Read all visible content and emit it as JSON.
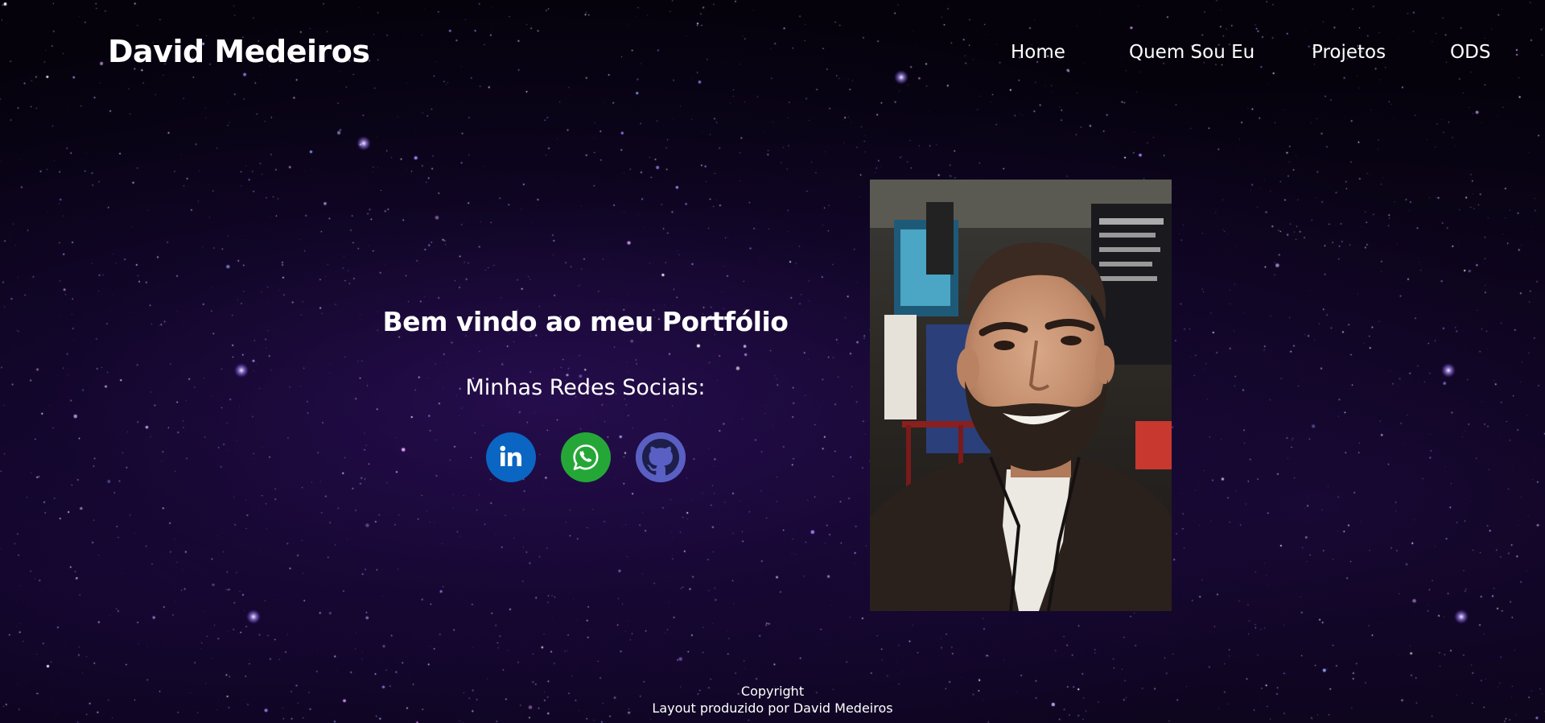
{
  "header": {
    "brand": "David Medeiros",
    "nav": [
      {
        "label": "Home"
      },
      {
        "label": "Quem Sou Eu"
      },
      {
        "label": "Projetos"
      },
      {
        "label": "ODS"
      }
    ]
  },
  "hero": {
    "title": "Bem vindo ao meu Portfólio",
    "social_label": "Minhas Redes Sociais:",
    "social": [
      {
        "icon": "linkedin-icon",
        "color": "#0a66c2"
      },
      {
        "icon": "whatsapp-icon",
        "color": "#25a737"
      },
      {
        "icon": "github-icon",
        "color": "#5a5fc3"
      }
    ]
  },
  "photo": {
    "icon": "profile-photo"
  },
  "footer": {
    "line1": "Copyright",
    "line2": "Layout produzido por David Medeiros"
  },
  "colors": {
    "background": "#05020c",
    "text": "#ffffff"
  }
}
